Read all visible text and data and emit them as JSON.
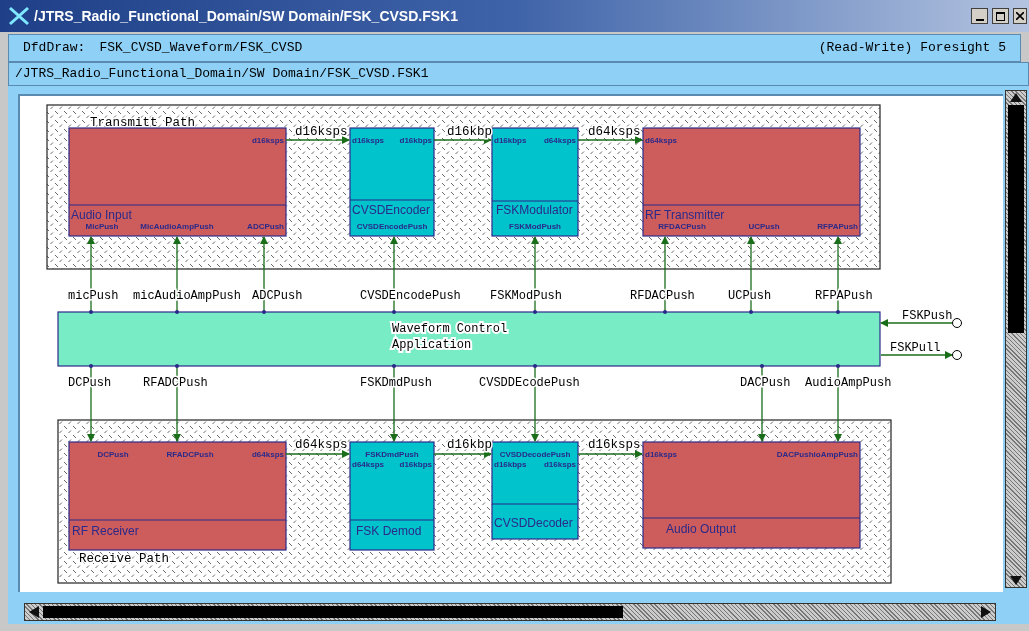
{
  "window": {
    "title": "/JTRS_Radio_Functional_Domain/SW Domain/FSK_CVSD.FSK1"
  },
  "info_bar": {
    "tool": "DfdDraw:",
    "diagram": "FSK_CVSD_Waveform/FSK_CVSD",
    "mode": "(Read-Write) Foresight 5"
  },
  "path_bar": "/JTRS_Radio_Functional_Domain/SW Domain/FSK_CVSD.FSK1",
  "diagram": {
    "transmit_path": {
      "label": "Transmitt Path",
      "processes": [
        {
          "name": "Audio Input",
          "kind": "hardware",
          "ports": [
            "d16ksps",
            "MicPush",
            "MicAudioAmpPush",
            "ADCPush"
          ]
        },
        {
          "name": "CVSDEncoder",
          "kind": "software",
          "ports": [
            "d16ksps",
            "d16kbps",
            "CVSDEncodePush"
          ]
        },
        {
          "name": "FSKModulator",
          "kind": "software",
          "ports": [
            "d16kbps",
            "d64ksps",
            "FSKModPush"
          ]
        },
        {
          "name": "RF Transmitter",
          "kind": "hardware",
          "ports": [
            "d64ksps",
            "RFDACPush",
            "UCPush",
            "RFPAPush"
          ]
        }
      ],
      "flows": [
        "d16ksps",
        "d16kbp",
        "d64ksps"
      ]
    },
    "control": {
      "label_lines": [
        "Waveform Control",
        "Application"
      ],
      "tx_signals": [
        "micPush",
        "micAudioAmpPush",
        "ADCPush",
        "CVSDEncodePush",
        "FSKModPush",
        "RFDACPush",
        "UCPush",
        "RFPAPush"
      ],
      "rx_signals": [
        "DCPush",
        "RFADCPush",
        "FSKDmdPush",
        "CVSDDEcodePush",
        "DACPush",
        "AudioAmpPush"
      ],
      "external_flows": [
        {
          "label": "FSKPush",
          "inbound": true
        },
        {
          "label": "FSKPull",
          "inbound": false
        }
      ]
    },
    "receive_path": {
      "label": "Receive Path",
      "processes": [
        {
          "name": "RF Receiver",
          "kind": "hardware",
          "ports": [
            "DCPush",
            "RFADCPush",
            "d64ksps"
          ]
        },
        {
          "name": "FSK Demod",
          "kind": "software",
          "ports": [
            "FSKDmdPush",
            "d64ksps",
            "d16kbps"
          ]
        },
        {
          "name": "CVSDDecoder",
          "kind": "software",
          "ports": [
            "CVSDDecodePush",
            "d16kbps",
            "d16ksps"
          ]
        },
        {
          "name": "Audio Output",
          "kind": "hardware",
          "ports": [
            "d16ksps",
            "DACPushioAmpPush"
          ]
        }
      ],
      "flows": [
        "d64ksps",
        "d16kbp",
        "d16ksps"
      ]
    }
  }
}
